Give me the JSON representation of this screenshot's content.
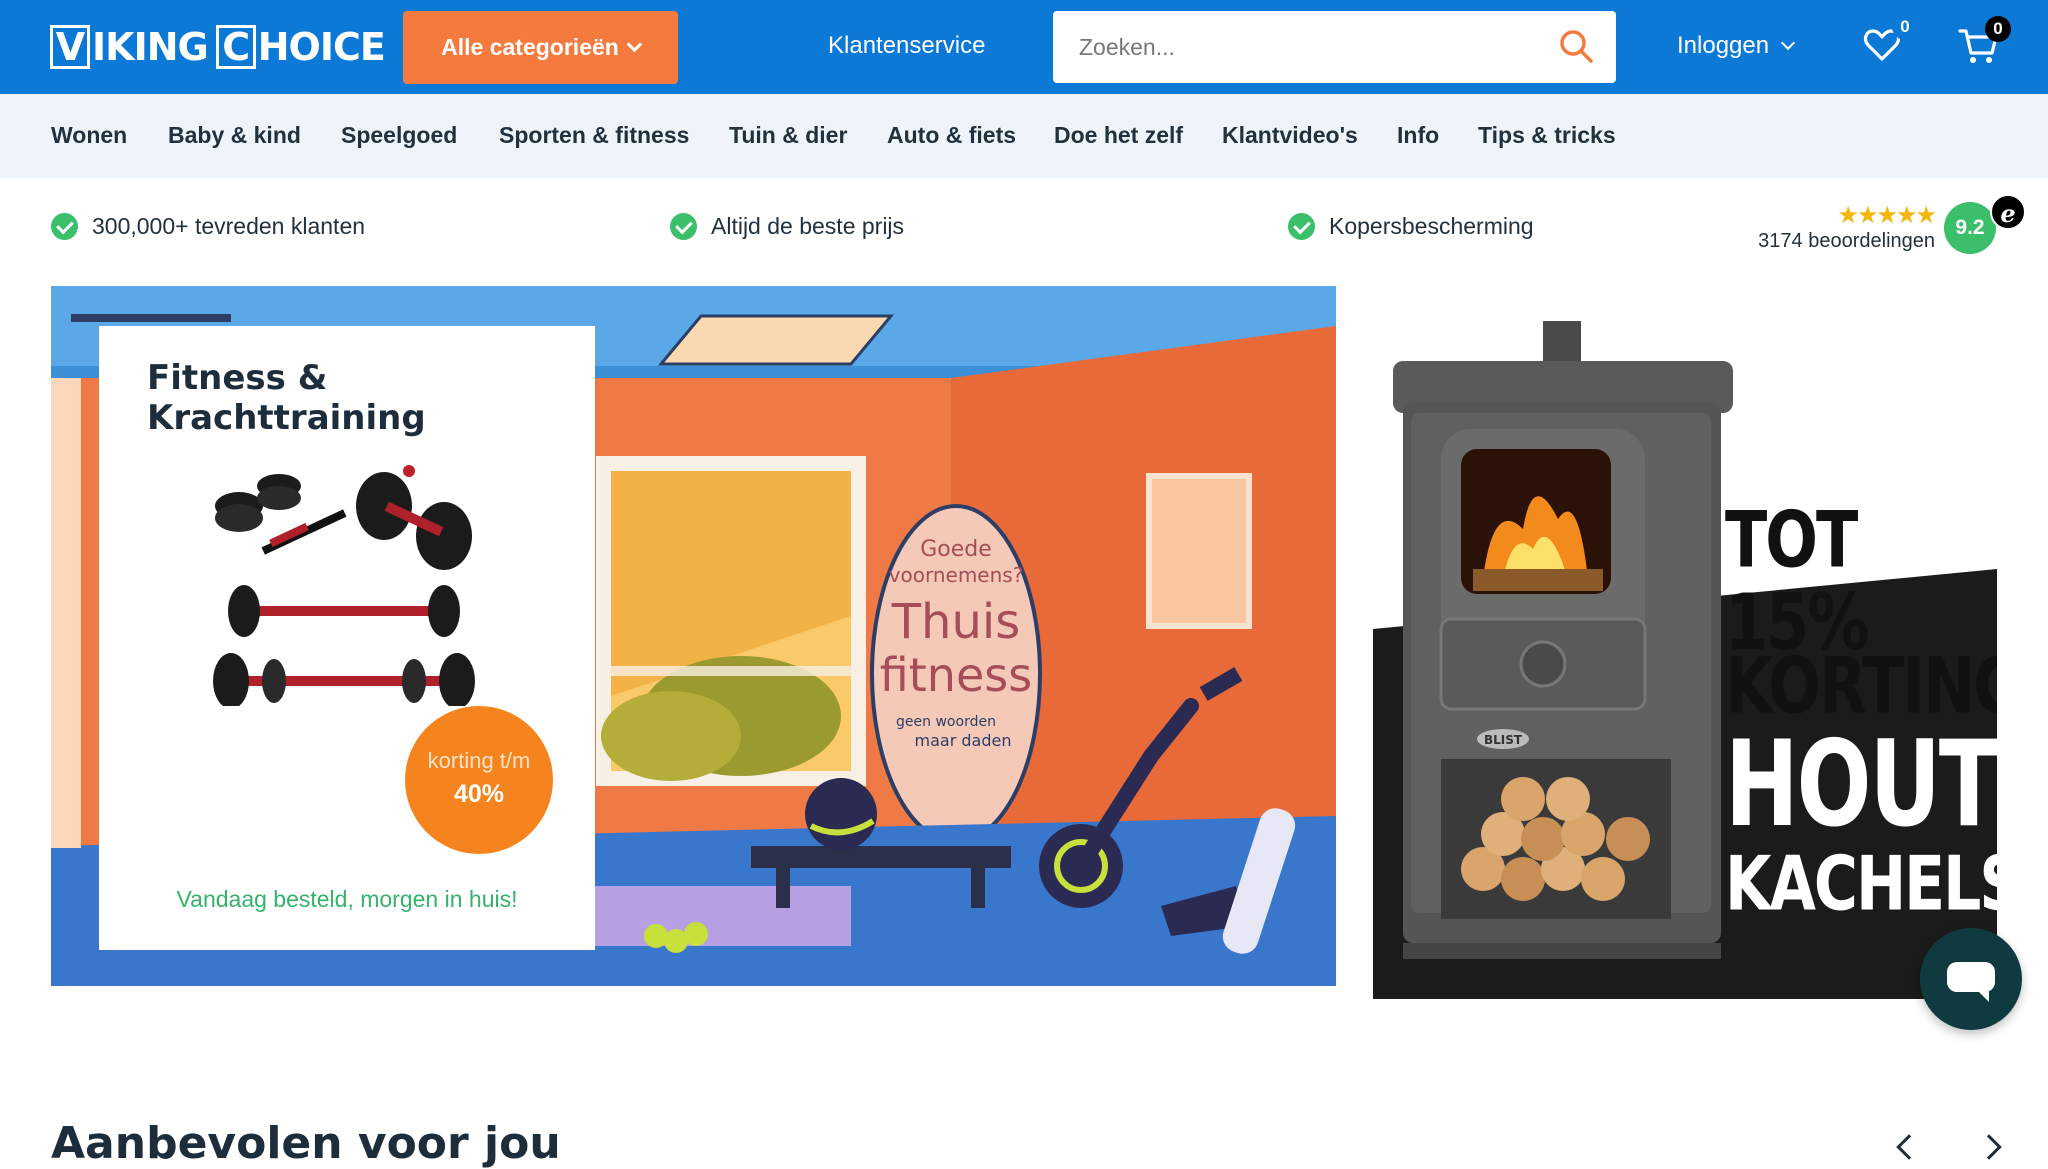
{
  "header": {
    "logo_part1": "V",
    "logo_part2": "IKING",
    "logo_part3": "C",
    "logo_part4": "HOICE",
    "categories_button": "Alle categorieën",
    "customer_service": "Klantenservice",
    "search_placeholder": "Zoeken...",
    "login": "Inloggen",
    "wishlist_count": "0",
    "cart_count": "0"
  },
  "nav": {
    "items": [
      "Wonen",
      "Baby & kind",
      "Speelgoed",
      "Sporten & fitness",
      "Tuin & dier",
      "Auto & fiets",
      "Doe het zelf",
      "Klantvideo's",
      "Info",
      "Tips & tricks"
    ]
  },
  "usps": [
    "300,000+ tevreden klanten",
    "Altijd de beste prijs",
    "Kopersbescherming"
  ],
  "reviews": {
    "stars": "★★★★★",
    "count": "3174 beoordelingen",
    "score": "9.2",
    "trust_mark": "e"
  },
  "promo_fitness": {
    "title": "Fitness & Krachttraining",
    "discount_label": "korting t/m",
    "discount_value": "40%",
    "delivery": "Vandaag besteld, morgen in huis!",
    "poster_line1": "Goede",
    "poster_line2": "voornemens?",
    "poster_line3": "Thuis",
    "poster_line4": "fitness",
    "poster_line5": "geen woorden",
    "poster_line6": "maar daden"
  },
  "promo_stoves": {
    "line1": "TOT 15%",
    "line2": "KORTING",
    "line3": "HOUT",
    "line4": "KACHELS",
    "stove_brand": "BLIST"
  },
  "recommended": {
    "title": "Aanbevolen voor jou"
  },
  "colors": {
    "brand_blue": "#0d79d6",
    "accent_orange": "#f57a3d",
    "nav_bg": "#eef4fa",
    "success_green": "#3bbf6a",
    "chat_bg": "#0f3b40"
  }
}
